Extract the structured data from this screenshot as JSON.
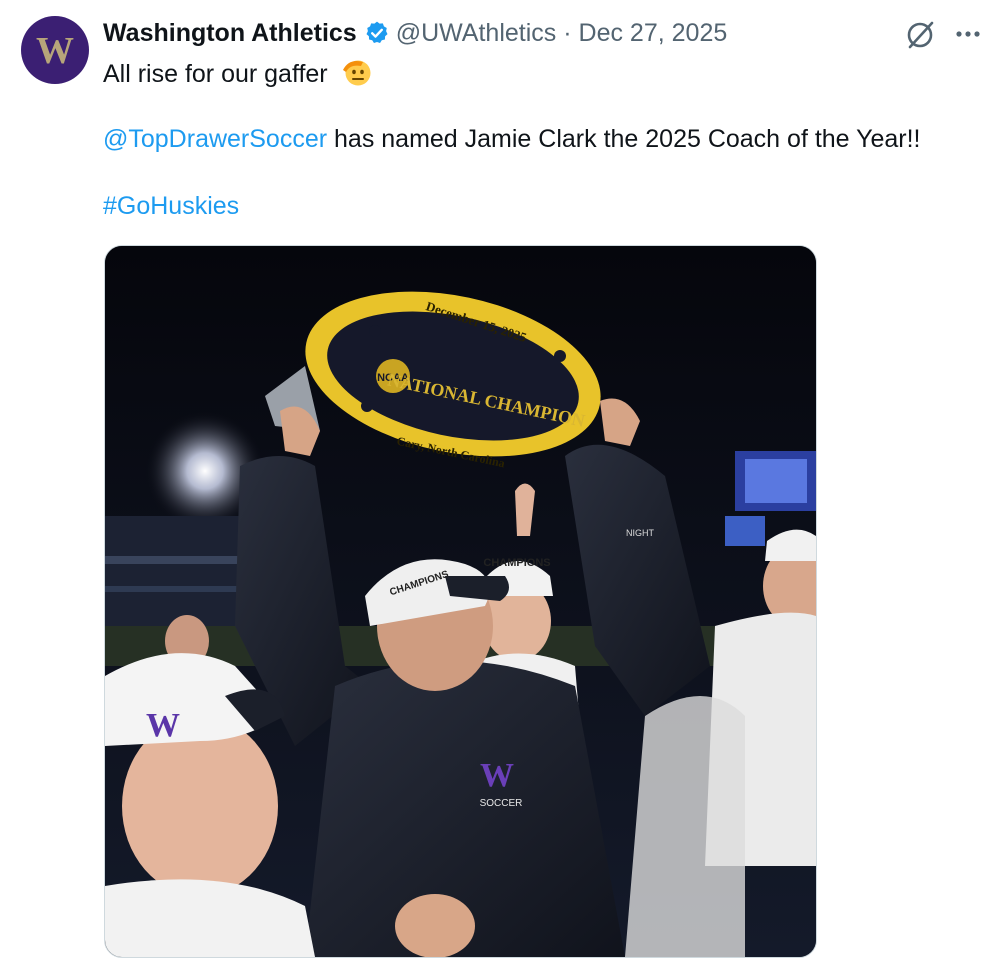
{
  "author": {
    "name": "Washington Athletics",
    "handle": "@UWAthletics",
    "separator": "·",
    "date": "Dec 27, 2025",
    "avatar_letter": "W",
    "brand_color": "#3b1f73",
    "verified_color": "#1d9bf0"
  },
  "tweet": {
    "line1": "All rise for our gaffer",
    "emoji": "saluting-face",
    "mention": "@TopDrawerSoccer",
    "line2_rest": " has named Jamie Clark the 2025 Coach of the Year!!",
    "hashtag": "#GoHuskies",
    "link_color": "#1d9bf0"
  },
  "media": {
    "trophy_date": "December 15, 2025",
    "trophy_logo": "NCAA",
    "trophy_title": "NATIONAL CHAMPION",
    "trophy_location": "Cary, North Carolina",
    "cap_text": "CHAMPIONS",
    "jacket_brand": "NIGHT",
    "jacket_logo": "W",
    "jacket_text": "SOCCER"
  },
  "icons": {
    "grok": "grok-icon",
    "more": "more-icon",
    "verified": "verified-badge-icon"
  }
}
